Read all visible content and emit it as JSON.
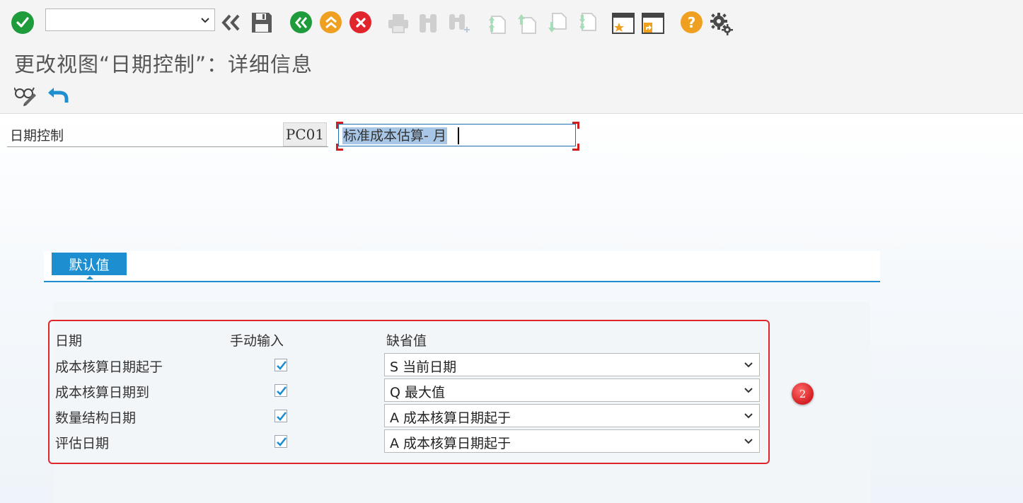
{
  "toolbar": {
    "command_field_value": "",
    "icons": [
      "enter-icon",
      "back-all-icon",
      "save-icon",
      "back-icon",
      "exit-icon",
      "cancel-icon",
      "print-icon",
      "find-icon",
      "find-next-icon",
      "first-page-icon",
      "previous-page-icon",
      "next-page-icon",
      "last-page-icon",
      "create-session-icon",
      "shortcut-icon",
      "help-icon",
      "settings-icon"
    ],
    "colors": {
      "green": "#1e9b3a",
      "orange": "#f0a020",
      "red": "#e0262c",
      "help": "#f0a020"
    }
  },
  "title": "更改视图“日期控制”：详细信息",
  "app_toolbar": {
    "icons": [
      "display-change-icon",
      "undo-icon"
    ]
  },
  "header": {
    "label": "日期控制",
    "key": "PC01",
    "description": "标准成本估算- 月"
  },
  "tab": {
    "label": "默认值",
    "accent": "#1d8fd0"
  },
  "table": {
    "columns": {
      "date": "日期",
      "manual": "手动输入",
      "default": "缺省值"
    },
    "rows": [
      {
        "label": "成本核算日期起于",
        "manual": true,
        "default": "S 当前日期"
      },
      {
        "label": "成本核算日期到",
        "manual": true,
        "default": "Q 最大值"
      },
      {
        "label": "数量结构日期",
        "manual": true,
        "default": "A 成本核算日期起于"
      },
      {
        "label": "评估日期",
        "manual": true,
        "default": "A 成本核算日期起于"
      }
    ]
  },
  "annotation": {
    "badge_text": "2",
    "highlight_color": "#e0262c"
  }
}
